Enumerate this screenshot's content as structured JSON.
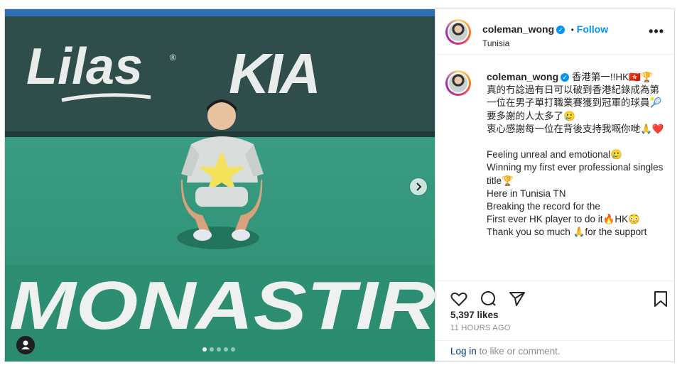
{
  "post": {
    "image": {
      "banner_left": "Lilas",
      "banner_right": "KIA",
      "court_text": "MONASTIR",
      "carousel_dots": 5,
      "active_dot": 1
    },
    "author": {
      "username": "coleman_wong",
      "follow_label": "Follow",
      "separator": "•",
      "location": "Tunisia"
    },
    "caption": {
      "username": "coleman_wong",
      "text": "香港第一!!HK🇭🇰🏆\n真的冇諗過有日可以破到香港紀錄成為第一位在男子單打職業賽獲到冠軍的球員🎾\n要多謝的人太多了🥲\n衷心感謝每一位在背後支持我嘅你哋🙏❤️\n\nFeeling unreal and emotional🥲\nWinning my first ever professional singles title🏆\nHere in Tunisia TN\nBreaking the record for the\nFirst ever HK player to do it🔥HK😳\nThank you so much 🙏for the support"
    },
    "likes": "5,397 likes",
    "timestamp": "11 HOURS AGO",
    "login": {
      "link": "Log in",
      "rest": " to like or comment."
    }
  },
  "colors": {
    "accent": "#0095f6",
    "text": "#262626",
    "muted": "#8e8e8e"
  }
}
